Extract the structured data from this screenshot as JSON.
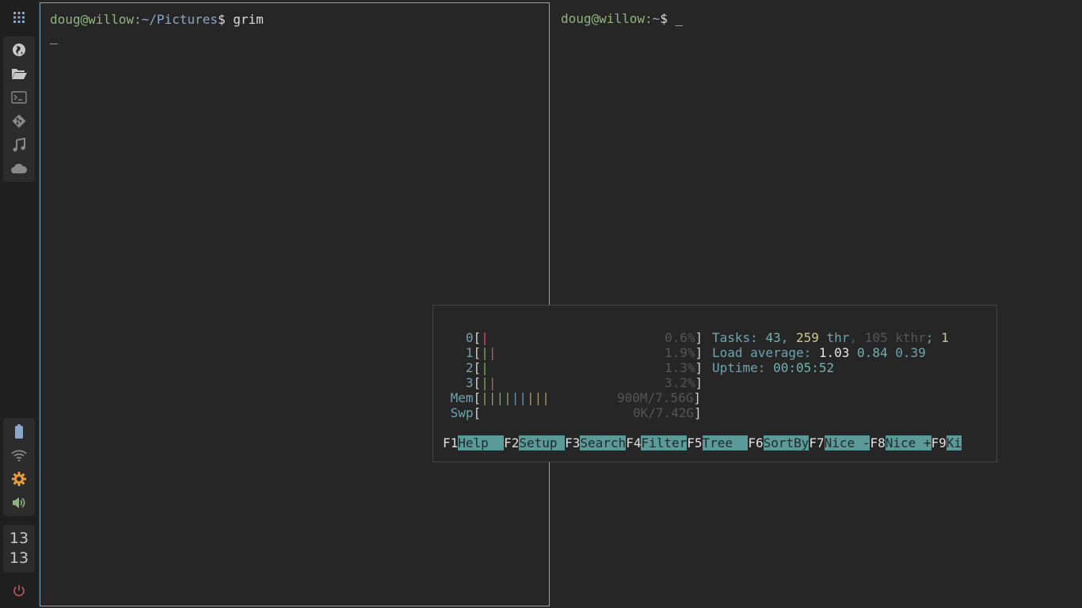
{
  "colors": {
    "background": "#262626",
    "sidebar": "#1f1f1f",
    "focus_border": "#7fa6c6",
    "prompt_user": "#8fb37f",
    "prompt_path": "#8aa6c8",
    "htop_label": "#6fa3ad",
    "htop_fkey_bg": "#5a9a98",
    "settings_accent": "#e69b3c",
    "power_accent": "#c45a5a"
  },
  "sidebar": {
    "launcher_icon": "apps-grid-icon",
    "apps": [
      "globe-icon",
      "folder-icon",
      "terminal-icon",
      "git-icon",
      "music-icon",
      "cloud-icon"
    ],
    "status": [
      "battery-icon",
      "wifi-icon",
      "settings-icon",
      "volume-icon"
    ],
    "clock": {
      "hours": "13",
      "minutes": "13"
    },
    "power_icon": "power-icon"
  },
  "terminal_left": {
    "user_host": "doug@willow",
    "path": "~/Pictures",
    "symbol": "$",
    "command": " grim",
    "cursor": "_"
  },
  "terminal_right": {
    "user_host": "doug@willow",
    "path": "~",
    "symbol": "$",
    "cursor": " _"
  },
  "htop": {
    "cpus": [
      {
        "label": "0",
        "bars": "|",
        "pct": "0.6%"
      },
      {
        "label": "1",
        "bars": "||",
        "pct": "1.9%"
      },
      {
        "label": "2",
        "bars": "|",
        "pct": "1.3%"
      },
      {
        "label": "3",
        "bars": "||",
        "pct": "3.2%"
      }
    ],
    "mem": {
      "label": "Mem",
      "bars": "|||||||||",
      "value": "900M/7.56G"
    },
    "swp": {
      "label": "Swp",
      "value": "0K/7.42G"
    },
    "tasks": {
      "label": "Tasks:",
      "count": "43",
      "sep1": ",",
      "threads": "259",
      "thr_label": "thr",
      "sep2": ",",
      "kthreads": "105",
      "kthr_label": "kthr",
      "sep3": ";",
      "running": "1"
    },
    "load": {
      "label": "Load average:",
      "v1": "1.03",
      "v5": "0.84",
      "v15": "0.39"
    },
    "uptime": {
      "label": "Uptime:",
      "value": "00:05:52"
    },
    "fkeys": [
      {
        "key": "F1",
        "label": "Help  "
      },
      {
        "key": "F2",
        "label": "Setup "
      },
      {
        "key": "F3",
        "label": "Search"
      },
      {
        "key": "F4",
        "label": "Filter"
      },
      {
        "key": "F5",
        "label": "Tree  "
      },
      {
        "key": "F6",
        "label": "SortBy"
      },
      {
        "key": "F7",
        "label": "Nice -"
      },
      {
        "key": "F8",
        "label": "Nice +"
      },
      {
        "key": "F9",
        "label": "Ki"
      }
    ]
  }
}
